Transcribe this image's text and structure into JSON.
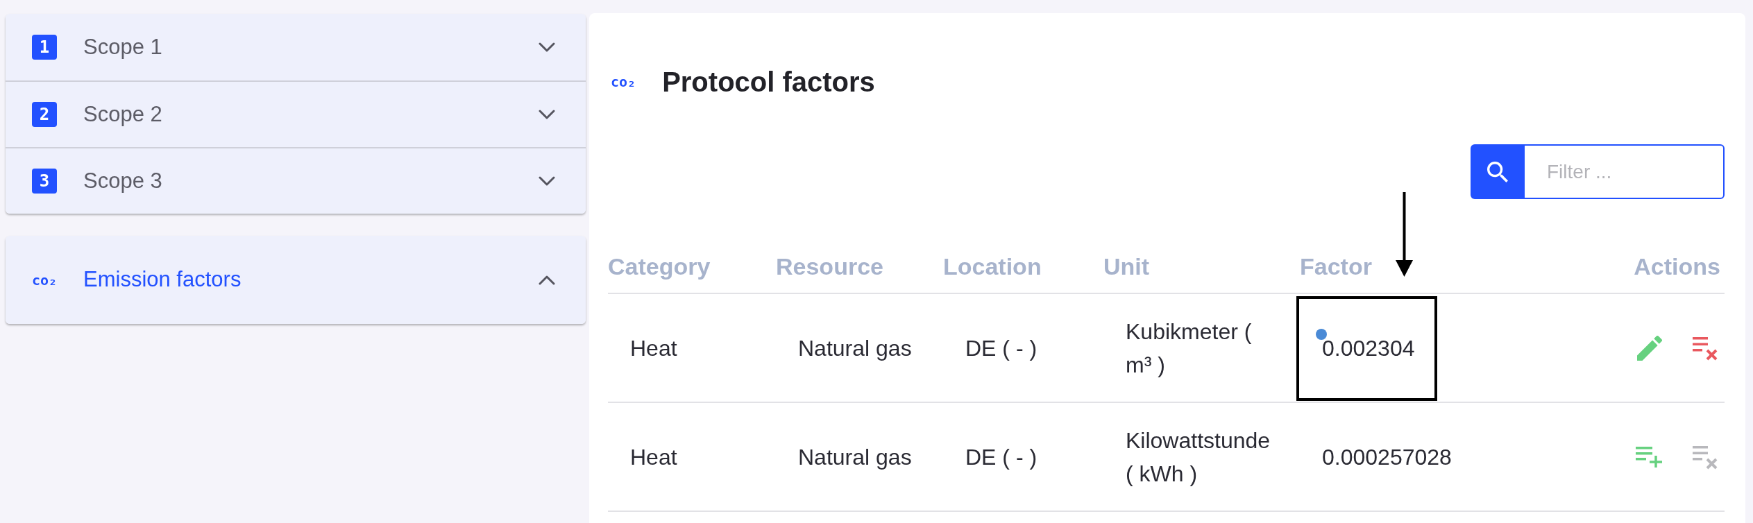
{
  "sidebar": {
    "groups": [
      {
        "items": [
          {
            "kind": "number",
            "badge": "1",
            "label": "Scope 1",
            "expanded": false
          },
          {
            "kind": "number",
            "badge": "2",
            "label": "Scope 2",
            "expanded": false
          },
          {
            "kind": "number",
            "badge": "3",
            "label": "Scope 3",
            "expanded": false
          }
        ]
      },
      {
        "items": [
          {
            "kind": "co2",
            "badge": "co₂",
            "label": "Emission factors",
            "expanded": true
          }
        ]
      }
    ]
  },
  "content": {
    "title": {
      "icon": "co₂",
      "text": "Protocol factors"
    },
    "filter": {
      "placeholder": "Filter ..."
    },
    "table": {
      "columns": [
        "Category",
        "Resource",
        "Location",
        "Unit",
        "Factor",
        "Actions"
      ],
      "rows": [
        {
          "cells": [
            "Heat",
            "Natural gas",
            "DE ( - )",
            "Kubikmeter ( m³ )",
            "0.002304"
          ],
          "highlighted": true,
          "actions": [
            {
              "kind": "edit",
              "disabled": false
            },
            {
              "kind": "remove",
              "disabled": false
            }
          ]
        },
        {
          "cells": [
            "Heat",
            "Natural gas",
            "DE ( - )",
            "Kilowattstunde ( kWh )",
            "0.000257028"
          ],
          "highlighted": false,
          "actions": [
            {
              "kind": "add",
              "disabled": false
            },
            {
              "kind": "remove",
              "disabled": true
            }
          ]
        }
      ]
    }
  }
}
